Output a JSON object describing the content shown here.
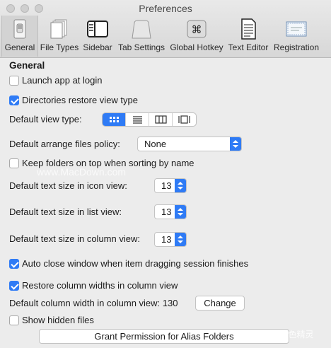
{
  "window": {
    "title": "Preferences"
  },
  "toolbar": {
    "items": [
      {
        "label": "General",
        "icon": "general-switch-icon",
        "selected": true
      },
      {
        "label": "File Types",
        "icon": "documents-icon"
      },
      {
        "label": "Sidebar",
        "icon": "sidebar-icon"
      },
      {
        "label": "Tab Settings",
        "icon": "tab-icon"
      },
      {
        "label": "Global Hotkey",
        "icon": "command-key-icon",
        "glyph": "⌘"
      },
      {
        "label": "Text Editor",
        "icon": "text-document-icon"
      },
      {
        "label": "Registration",
        "icon": "certificate-icon"
      }
    ]
  },
  "general": {
    "heading": "General",
    "launch_at_login": {
      "label": "Launch app at login",
      "checked": false
    },
    "restore_view_type": {
      "label": "Directories restore view type",
      "checked": true
    },
    "default_view_type": {
      "label": "Default view type:",
      "selected": "icon"
    },
    "arrange_policy": {
      "label": "Default arrange files policy:",
      "value": "None"
    },
    "folders_on_top": {
      "label": "Keep folders on top when sorting by name",
      "checked": false
    },
    "text_size_icon": {
      "label": "Default text size in icon view:",
      "value": "13"
    },
    "text_size_list": {
      "label": "Default text size in list view:",
      "value": "13"
    },
    "text_size_column": {
      "label": "Default text size in column view:",
      "value": "13"
    },
    "auto_close": {
      "label": "Auto close window when item dragging session finishes",
      "checked": true
    },
    "restore_col_widths": {
      "label": "Restore column widths in column view",
      "checked": true
    },
    "column_width": {
      "label": "Default column width in column view: 130",
      "button": "Change"
    },
    "show_hidden": {
      "label": "Show hidden files",
      "checked": false
    },
    "grant_permission": {
      "button": "Grant Permission for Alias Folders"
    }
  },
  "watermarks": {
    "left": "www.MacDown.com",
    "right": "知乎 @青色精灵"
  },
  "colors": {
    "accent": "#2f7bf5",
    "window_bg": "#ececec"
  }
}
